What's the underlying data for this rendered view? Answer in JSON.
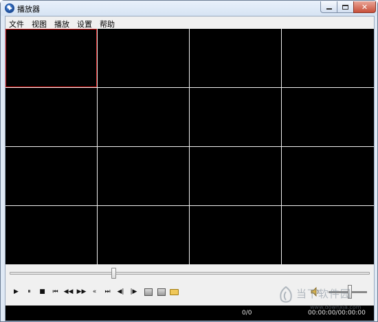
{
  "window": {
    "title": "播放器"
  },
  "title_buttons": {
    "minimize": "—",
    "maximize": "□",
    "close": "✕"
  },
  "menu": [
    "文件",
    "视图",
    "播放",
    "设置",
    "帮助"
  ],
  "grid": {
    "rows": 4,
    "cols": 4,
    "selected_index": 0
  },
  "seek": {
    "position_fraction": 0.28
  },
  "controls": [
    {
      "name": "play-icon",
      "glyph": "▶"
    },
    {
      "name": "pause-icon",
      "glyph": "⏸"
    },
    {
      "name": "stop-icon",
      "glyph": "■"
    },
    {
      "name": "prev-file-icon",
      "glyph": "⏮"
    },
    {
      "name": "rewind-icon",
      "glyph": "◀◀"
    },
    {
      "name": "fast-forward-icon",
      "glyph": "▶▶"
    },
    {
      "name": "slower-icon",
      "glyph": "«"
    },
    {
      "name": "next-file-icon",
      "glyph": "⏭"
    },
    {
      "name": "step-back-icon",
      "glyph": "◀|"
    },
    {
      "name": "step-forward-icon",
      "glyph": "|▶"
    },
    {
      "name": "snapshot-icon",
      "glyph": ""
    },
    {
      "name": "zoom-icon",
      "glyph": ""
    },
    {
      "name": "open-folder-icon",
      "glyph": ""
    }
  ],
  "volume": {
    "level_fraction": 0.5
  },
  "status": {
    "count": "0/0",
    "time": "00:00:00/00:00:00"
  },
  "watermark": {
    "text": "当下软件园",
    "url": "www.downxia.com"
  },
  "colors": {
    "video_bg": "#000000",
    "selected_border": "#cc1414",
    "status_bg": "#000000"
  }
}
